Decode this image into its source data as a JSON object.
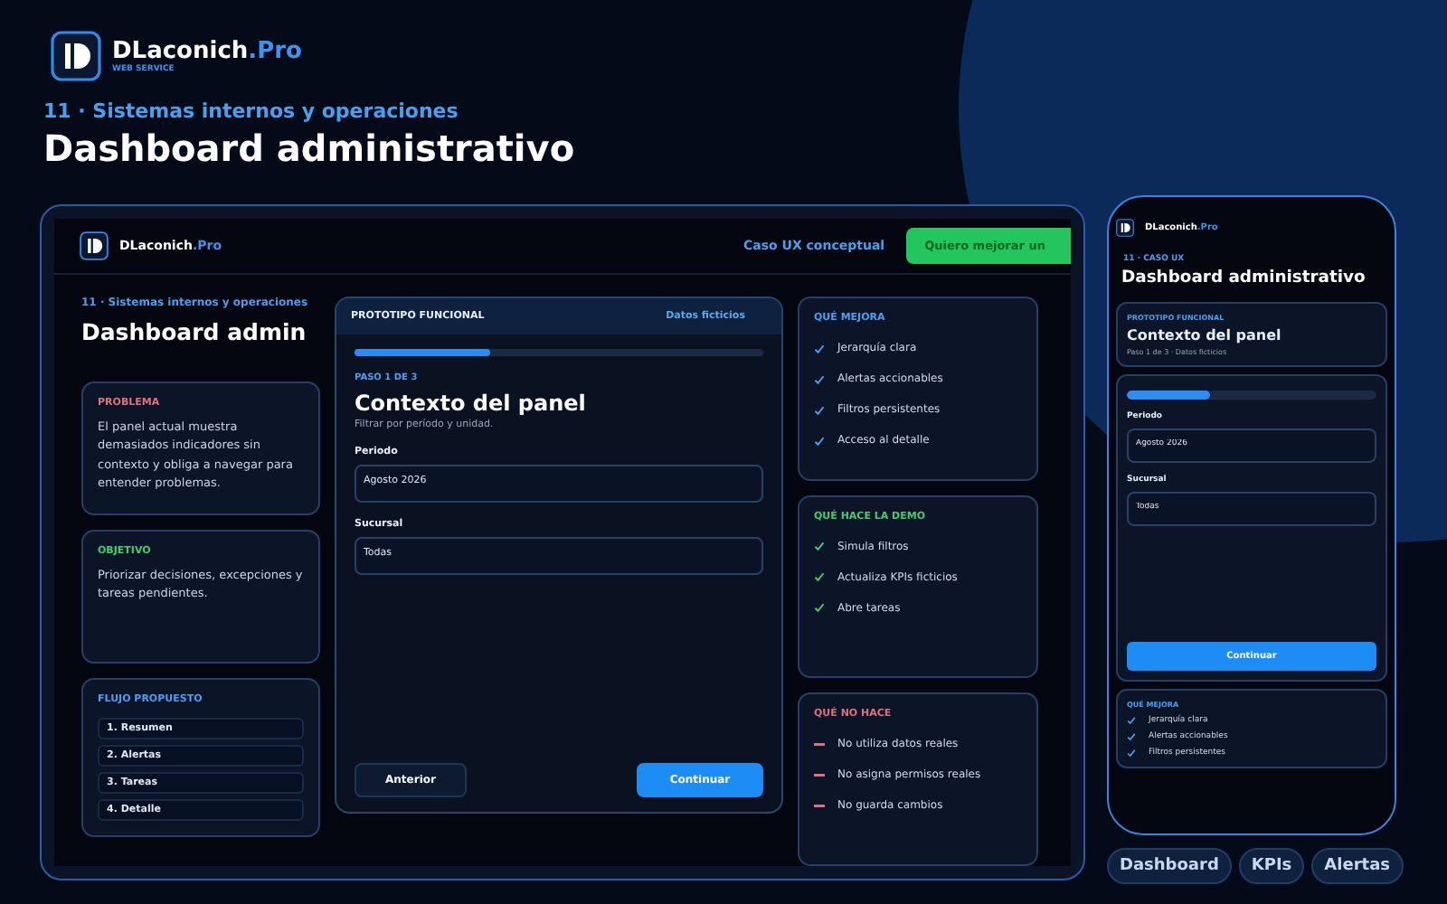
{
  "brand": {
    "name": "DLaconich",
    "suffix": ".Pro",
    "tagline": "WEB SERVICE"
  },
  "eyebrow": "11 · Sistemas internos y operaciones",
  "title": "Dashboard administrativo",
  "desktop": {
    "brand": {
      "name": "DLaconich",
      "suffix": ".Pro"
    },
    "nav_link": "Caso UX conceptual",
    "cta": "Quiero mejorar un",
    "eyebrow": "11 · Sistemas internos y operaciones",
    "title": "Dashboard admin",
    "info_cards": [
      {
        "label": "PROBLEMA",
        "color": "#e0707e",
        "text": "El panel actual muestra demasiados indicadores sin contexto y obliga a navegar para entender problemas."
      },
      {
        "label": "OBJETIVO",
        "color": "#3ecf6e",
        "text": "Priorizar decisiones, excepciones y tareas pendientes."
      }
    ],
    "flow": {
      "label": "FLUJO PROPUESTO",
      "steps": [
        "1. Resumen",
        "2. Alertas",
        "3. Tareas",
        "4. Detalle"
      ]
    },
    "prototype": {
      "header": "PROTOTIPO FUNCIONAL",
      "badge": "Datos ficticios",
      "level": 0.33,
      "step": "PASO 1 DE 3",
      "heading": "Contexto del panel",
      "subtitle": "Filtrar por período y unidad.",
      "fields": [
        {
          "label": "Periodo",
          "value": "Agosto 2026"
        },
        {
          "label": "Sucursal",
          "value": "Todas"
        }
      ],
      "buttons": [
        {
          "kind": "secondary",
          "label": "Anterior"
        },
        {
          "kind": "primary",
          "label": "Continuar"
        }
      ]
    },
    "lists": [
      {
        "label": "QUÉ MEJORA",
        "kind": "check",
        "color": "#4aa0f0",
        "items": [
          "Jerarquía clara",
          "Alertas accionables",
          "Filtros persistentes",
          "Acceso al detalle"
        ]
      },
      {
        "label": "QUÉ HACE LA DEMO",
        "kind": "check",
        "color": "#3ecf6e",
        "items": [
          "Simula filtros",
          "Actualiza KPIs ficticios",
          "Abre tareas"
        ]
      },
      {
        "label": "QUÉ NO HACE",
        "kind": "dash",
        "color": "#e0707e",
        "items": [
          "No utiliza datos reales",
          "No asigna permisos reales",
          "No guarda cambios"
        ]
      }
    ]
  },
  "phone": {
    "brand": {
      "name": "DLaconich",
      "suffix": ".Pro"
    },
    "eyebrow": "11 · CASO UX",
    "title": "Dashboard administrativo",
    "summary": {
      "label": "PROTOTIPO FUNCIONAL",
      "heading": "Contexto del panel",
      "meta": "Paso 1 de 3 · Datos ficticios"
    },
    "level": 0.33,
    "fields": [
      {
        "label": "Periodo",
        "value": "Agosto 2026"
      },
      {
        "label": "Sucursal",
        "value": "Todas"
      }
    ],
    "button": "Continuar",
    "list": {
      "label": "QUÉ MEJORA",
      "kind": "check",
      "color": "#4aa0f0",
      "items": [
        "Jerarquía clara",
        "Alertas accionables",
        "Filtros persistentes"
      ]
    }
  },
  "tags": [
    "Dashboard",
    "KPIs",
    "Alertas"
  ]
}
